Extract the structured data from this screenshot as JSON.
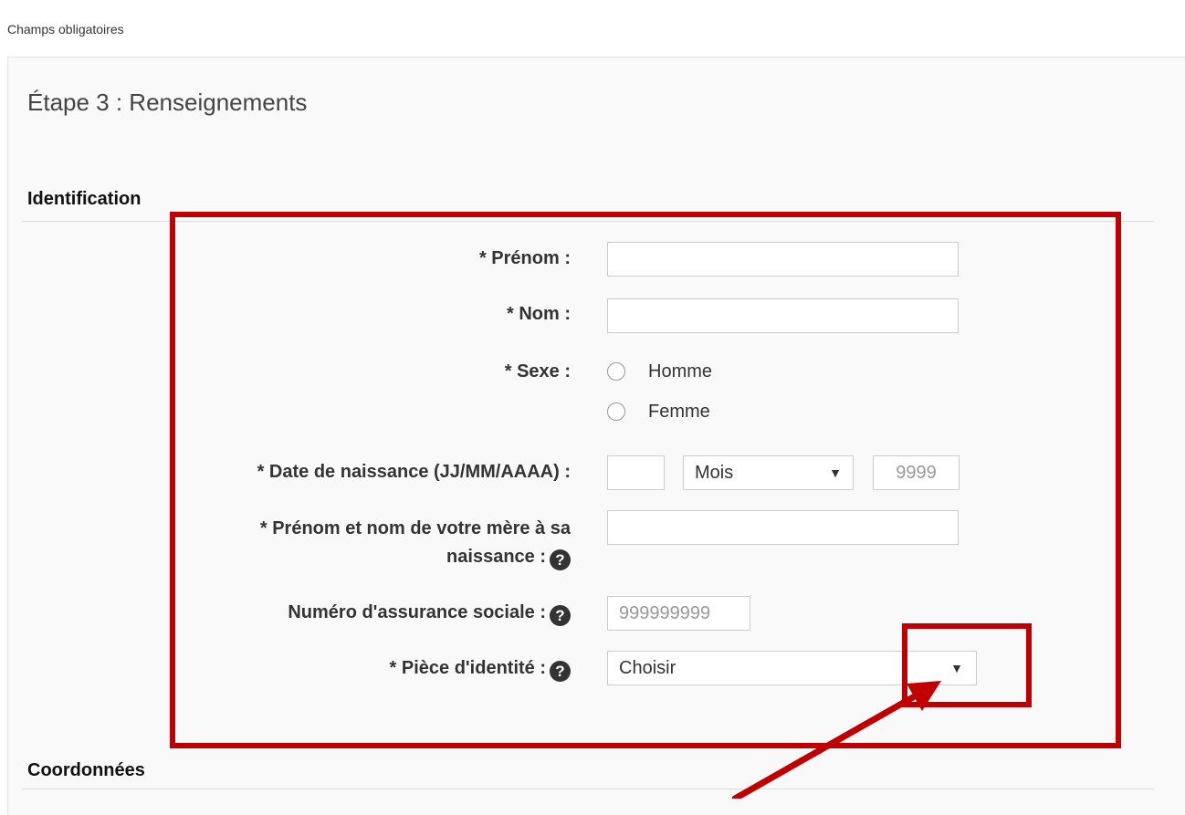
{
  "page": {
    "required_note": "Champs obligatoires",
    "step_title": "Étape 3 : Renseignements"
  },
  "identification": {
    "title": "Identification",
    "first_name": {
      "label": "* Prénom :",
      "value": ""
    },
    "last_name": {
      "label": "* Nom :",
      "value": ""
    },
    "sex": {
      "label": "* Sexe :",
      "options": [
        "Homme",
        "Femme"
      ]
    },
    "birth_date": {
      "label": "* Date de naissance (JJ/MM/AAAA) :",
      "day_value": "",
      "month_selected": "Mois",
      "year_placeholder": "9999"
    },
    "mother_name": {
      "label_line1": "* Prénom et nom de votre mère à sa",
      "label_line2": "naissance :",
      "value": ""
    },
    "sin": {
      "label": "Numéro d'assurance sociale :",
      "placeholder": "999999999"
    },
    "id_document": {
      "label": "* Pièce d'identité :",
      "selected": "Choisir"
    },
    "help_glyph": "?"
  },
  "contact": {
    "title": "Coordonnées"
  },
  "icons": {
    "help": "question-circle-icon",
    "select_caret": "triangle-down-icon",
    "annotation_arrow": "arrow-icon"
  },
  "colors": {
    "annotation": "#c00000",
    "panel_bg": "#f9f9f9",
    "help_icon": "#333333"
  }
}
